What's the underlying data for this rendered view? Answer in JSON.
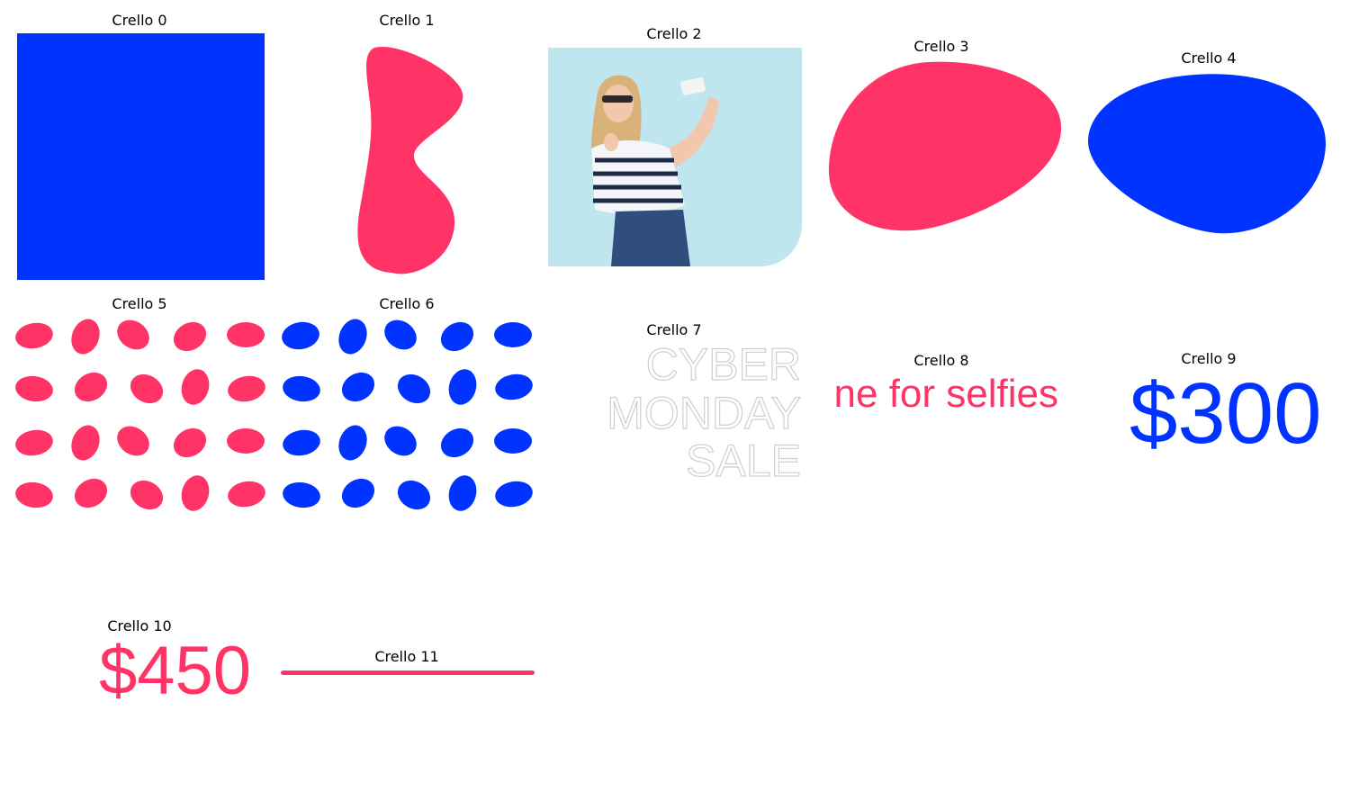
{
  "colors": {
    "blue": "#0033ff",
    "pink": "#ff3366",
    "photo_bg": "#bfe5ef"
  },
  "cells": [
    {
      "title": "Crello 0",
      "kind": "blue-square"
    },
    {
      "title": "Crello 1",
      "kind": "pink-bone-blob"
    },
    {
      "title": "Crello 2",
      "kind": "photo-woman-selfie"
    },
    {
      "title": "Crello 3",
      "kind": "pink-blob"
    },
    {
      "title": "Crello 4",
      "kind": "blue-blob"
    },
    {
      "title": "Crello 5",
      "kind": "pink-dot-pattern"
    },
    {
      "title": "Crello 6",
      "kind": "blue-dot-pattern"
    },
    {
      "title": "Crello 7",
      "kind": "outline-text"
    },
    {
      "title": "Crello 8",
      "kind": "text"
    },
    {
      "title": "Crello 9",
      "kind": "price"
    },
    {
      "title": "Crello 10",
      "kind": "price"
    },
    {
      "title": "Crello 11",
      "kind": "pink-line"
    }
  ],
  "texts": {
    "cyber_line1": "CYBER",
    "cyber_line2": "MONDAY",
    "cyber_line3": "SALE",
    "selfies": "ne for selfies",
    "price_300": "$300",
    "price_450": "$450"
  }
}
